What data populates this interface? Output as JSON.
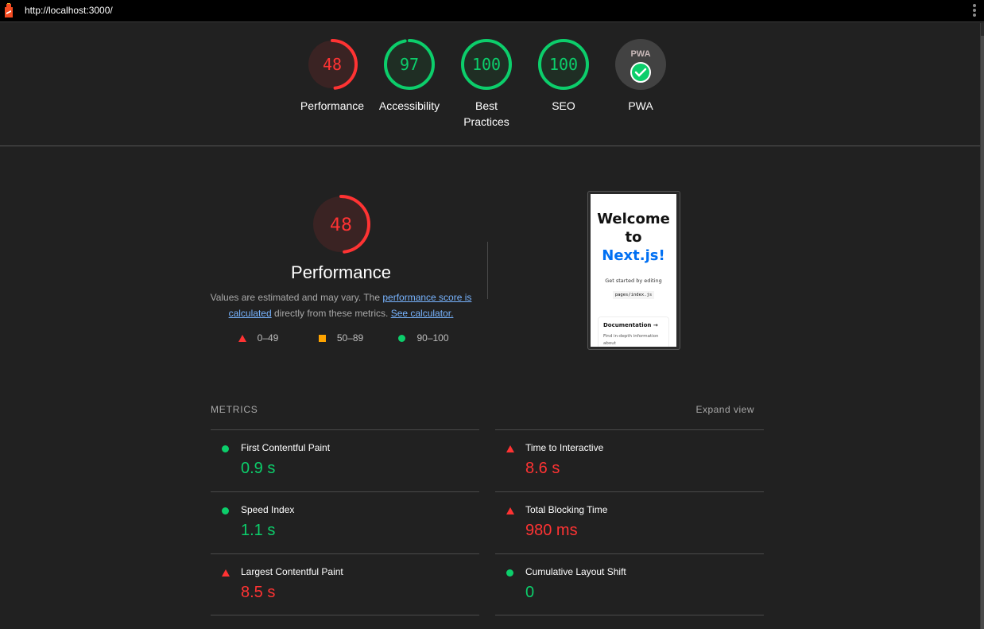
{
  "topbar": {
    "url": "http://localhost:3000/"
  },
  "scores": [
    {
      "label": "Performance",
      "value": "48",
      "score": 48,
      "status": "fail"
    },
    {
      "label": "Accessibility",
      "value": "97",
      "score": 97,
      "status": "pass"
    },
    {
      "label": "Best Practices",
      "value": "100",
      "score": 100,
      "status": "pass"
    },
    {
      "label": "SEO",
      "value": "100",
      "score": 100,
      "status": "pass"
    },
    {
      "label": "PWA",
      "value": "",
      "badge": "PWA",
      "status": "pwa-installable"
    }
  ],
  "performance": {
    "score": 48,
    "value": "48",
    "title": "Performance",
    "desc_prefix": "Values are estimated and may vary. The ",
    "link1": "performance score is calculated",
    "desc_mid": " directly from these metrics. ",
    "link2": "See calculator.",
    "legend": [
      {
        "range": "0–49",
        "shape": "triangle",
        "color": "#ff3333"
      },
      {
        "range": "50–89",
        "shape": "square",
        "color": "#ffa400"
      },
      {
        "range": "90–100",
        "shape": "circle",
        "color": "#0cce6b"
      }
    ]
  },
  "screenshot": {
    "line1": "Welcome",
    "line2": "to",
    "line3": "Next.js!",
    "started": "Get started by editing",
    "code": "pages/index.js",
    "card_title": "Documentation →",
    "card_desc": "Find in-depth information about"
  },
  "metrics": {
    "header": "METRICS",
    "expand": "Expand view",
    "items": [
      {
        "name": "First Contentful Paint",
        "value": "0.9 s",
        "status": "pass"
      },
      {
        "name": "Time to Interactive",
        "value": "8.6 s",
        "status": "fail"
      },
      {
        "name": "Speed Index",
        "value": "1.1 s",
        "status": "pass"
      },
      {
        "name": "Total Blocking Time",
        "value": "980 ms",
        "status": "fail"
      },
      {
        "name": "Largest Contentful Paint",
        "value": "8.5 s",
        "status": "fail"
      },
      {
        "name": "Cumulative Layout Shift",
        "value": "0",
        "status": "pass"
      }
    ]
  },
  "colors": {
    "pass": "#0cce6b",
    "average": "#ffa400",
    "fail": "#ff3333",
    "link": "#78b4ff"
  }
}
